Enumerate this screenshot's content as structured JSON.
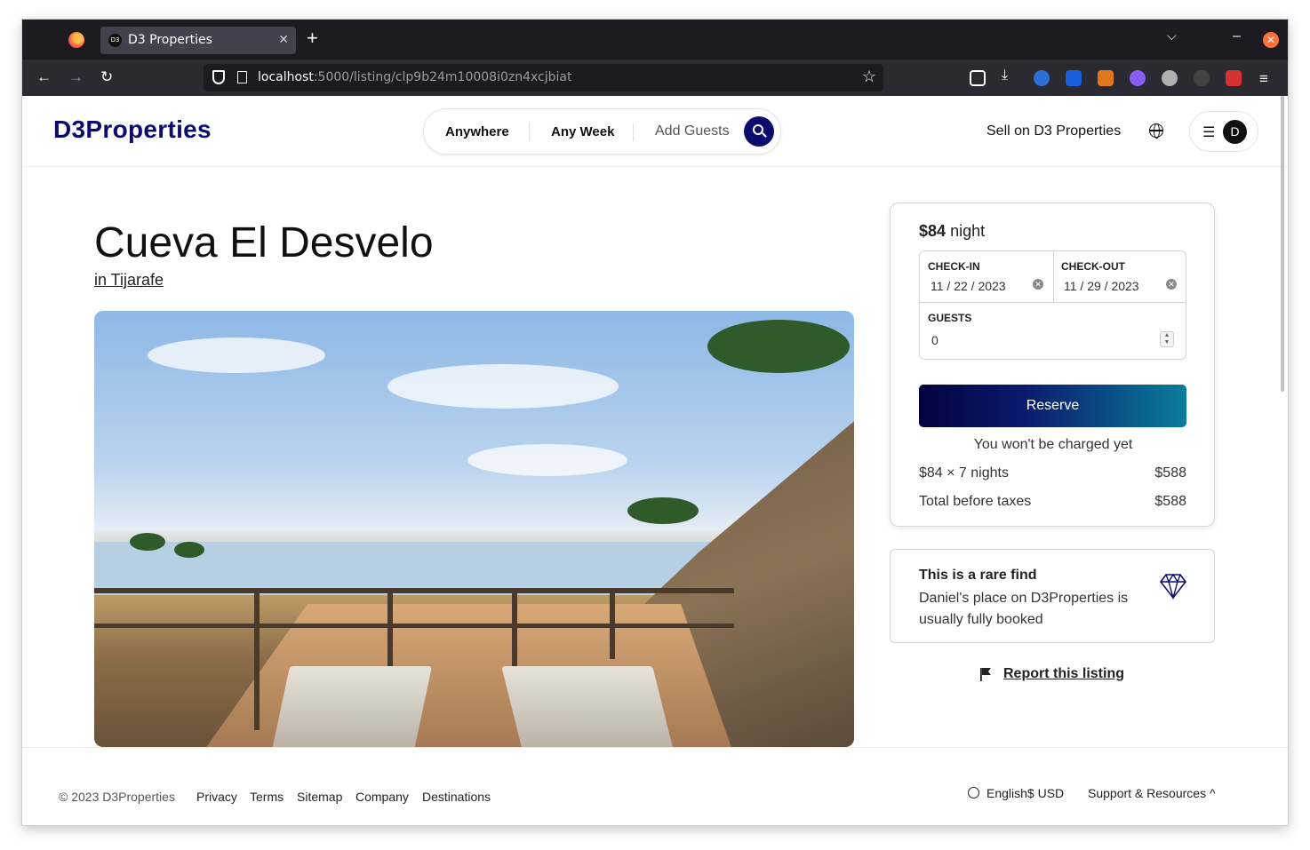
{
  "browser": {
    "tab_title": "D3 Properties",
    "tab_favicon": "D3",
    "url_host": "localhost",
    "url_path": ":5000/listing/clp9b24m10008i0zn4xcjbiat"
  },
  "header": {
    "logo": "D3Properties",
    "search": {
      "anywhere": "Anywhere",
      "any_week": "Any Week",
      "add_guests": "Add Guests"
    },
    "sell_link": "Sell on D3 Properties",
    "avatar_initial": "D"
  },
  "listing": {
    "title": "Cueva El Desvelo",
    "location": "in Tijarafe"
  },
  "booking": {
    "price": "$84",
    "price_unit": "night",
    "check_in_label": "CHECK-IN",
    "check_in_value": "11 / 22 / 2023",
    "check_out_label": "CHECK-OUT",
    "check_out_value": "11 / 29 / 2023",
    "guests_label": "GUESTS",
    "guests_value": "0",
    "reserve_label": "Reserve",
    "no_charge": "You won't be charged yet",
    "nights_line": "$84 × 7 nights",
    "nights_amount": "$588",
    "total_label": "Total before taxes",
    "total_amount": "$588"
  },
  "rare_find": {
    "title": "This is a rare find",
    "text": "Daniel's place on D3Properties is usually fully booked"
  },
  "report": "Report this listing",
  "footer": {
    "copyright": "© 2023 D3Properties",
    "links": [
      "Privacy",
      "Terms",
      "Sitemap",
      "Company",
      "Destinations"
    ],
    "language": "English$ USD",
    "support": "Support & Resources"
  },
  "colors": {
    "brand": "#0c0c6e",
    "reserve_gradient_start": "#03033f",
    "reserve_gradient_end": "#0a7d9a"
  }
}
